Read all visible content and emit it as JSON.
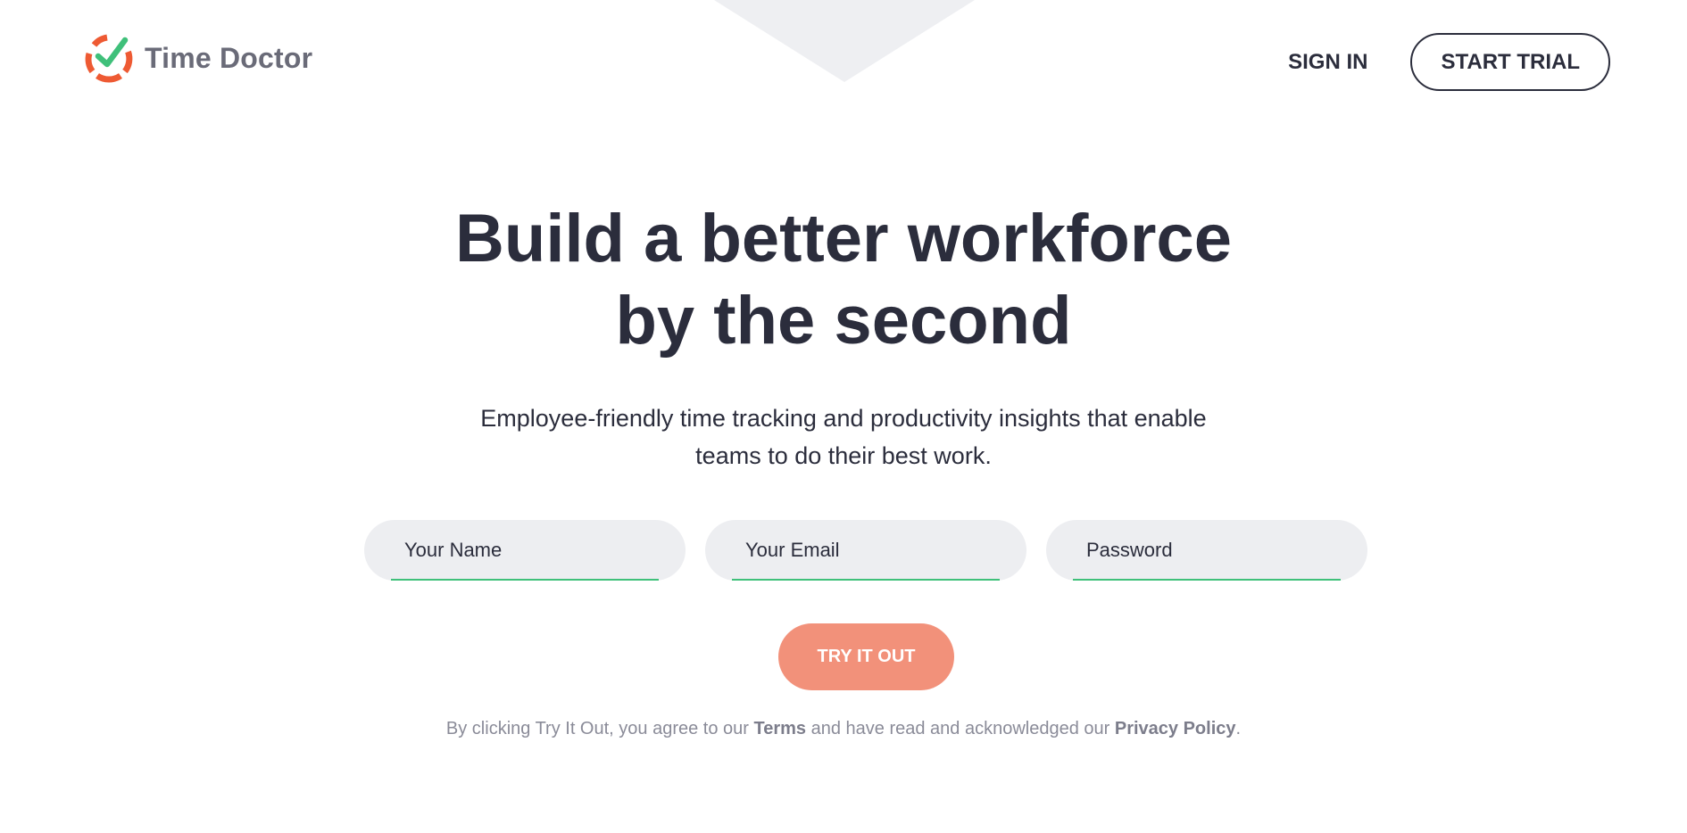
{
  "header": {
    "brand_name": "Time Doctor",
    "logo_icon": "time-doctor-clock-check-icon",
    "nav": {
      "sign_in_label": "SIGN IN",
      "start_trial_label": "START TRIAL"
    }
  },
  "hero": {
    "title_line_1": "Build a better workforce",
    "title_line_2": "by the second",
    "subtitle_line_1": "Employee-friendly time tracking and productivity insights that enable",
    "subtitle_line_2": "teams to do their best work."
  },
  "signup_form": {
    "name_placeholder": "Your Name",
    "email_placeholder": "Your Email",
    "password_placeholder": "Password",
    "submit_label": "TRY IT OUT"
  },
  "legal": {
    "text_before_terms": "By clicking Try It Out, you agree to our ",
    "terms_label": "Terms",
    "text_middle": " and have read and acknowledged our ",
    "privacy_label": "Privacy Policy",
    "text_after": "."
  },
  "colors": {
    "brand_orange": "#ee5a33",
    "brand_green": "#3fc07a",
    "text_dark": "#2b2d3c",
    "cta_salmon": "#f2917a",
    "field_bg": "#edeef1"
  }
}
